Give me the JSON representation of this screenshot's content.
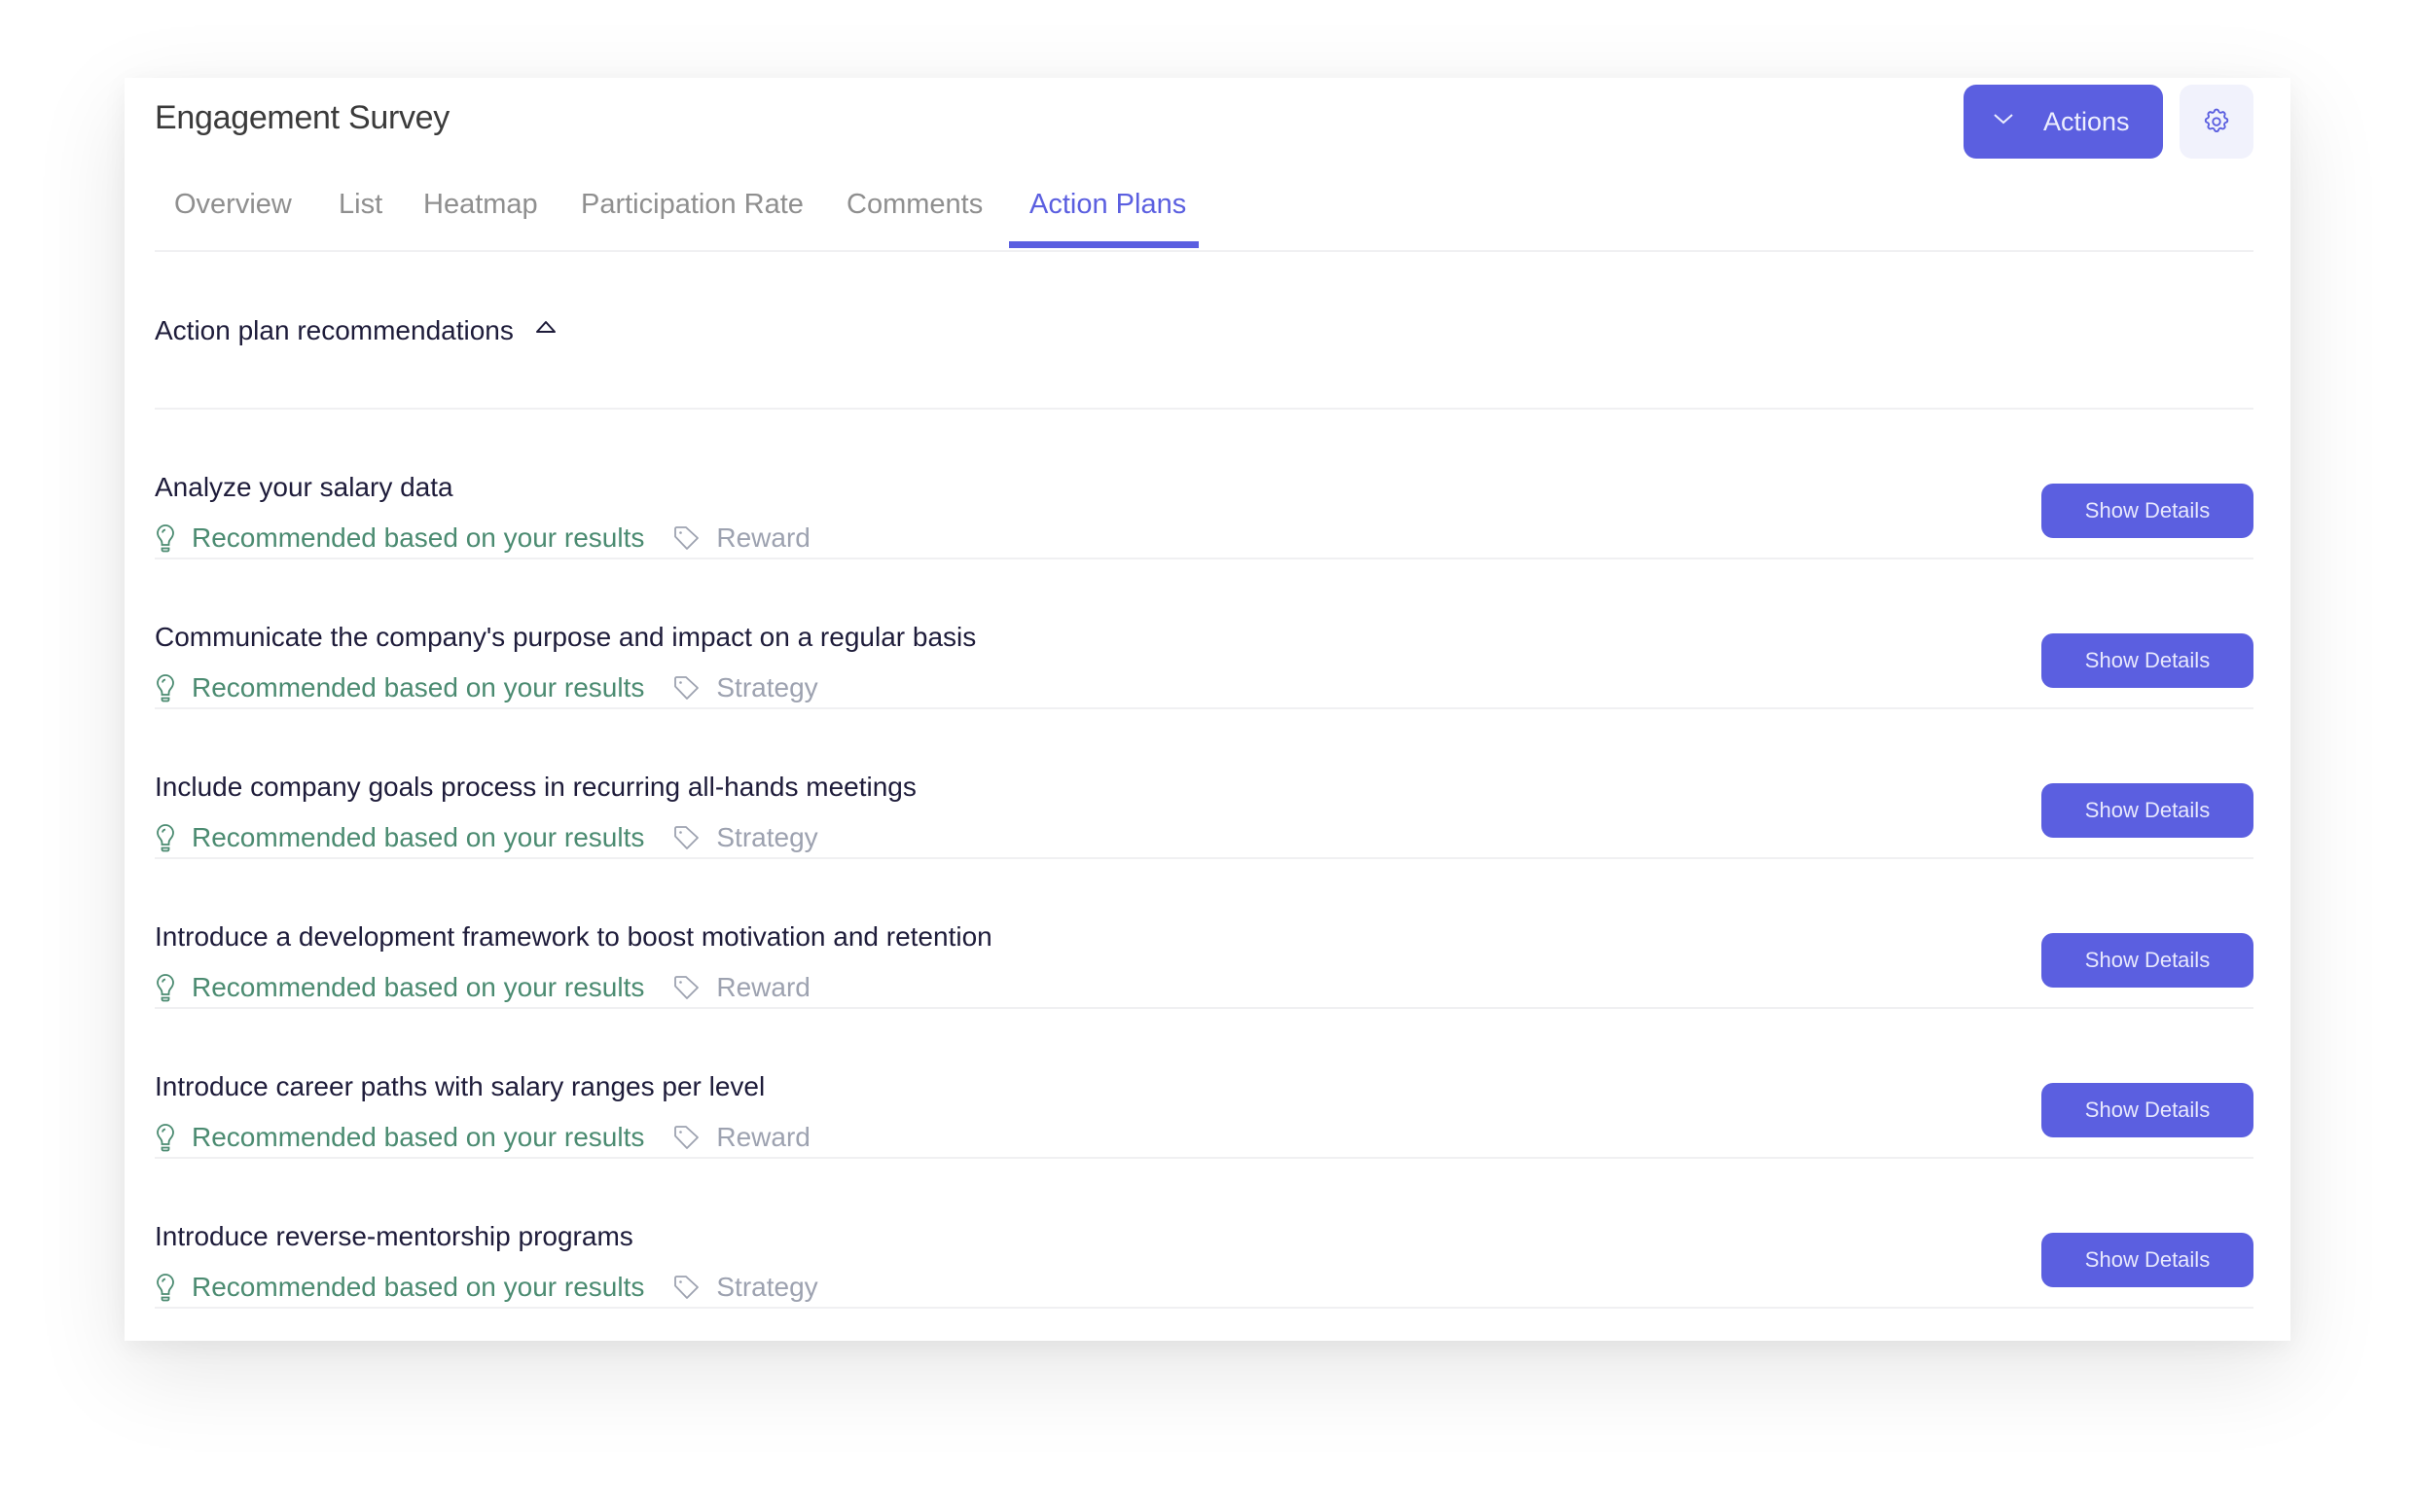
{
  "header": {
    "title": "Engagement Survey",
    "actions_label": "Actions",
    "actions_icon": "chevron-down-icon",
    "settings_icon": "gear-icon"
  },
  "tabs": [
    {
      "label": "Overview",
      "active": false
    },
    {
      "label": "List",
      "active": false
    },
    {
      "label": "Heatmap",
      "active": false
    },
    {
      "label": "Participation Rate",
      "active": false
    },
    {
      "label": "Comments",
      "active": false
    },
    {
      "label": "Action Plans",
      "active": true
    }
  ],
  "section": {
    "title": "Action plan recommendations",
    "expanded": true
  },
  "items": [
    {
      "title": "Analyze your salary data",
      "recommendation": "Recommended based on your results",
      "category": "Reward",
      "button": "Show Details"
    },
    {
      "title": "Communicate the company's purpose and impact on a regular basis",
      "recommendation": "Recommended based on your results",
      "category": "Strategy",
      "button": "Show Details"
    },
    {
      "title": "Include company goals process in recurring all-hands meetings",
      "recommendation": "Recommended based on your results",
      "category": "Strategy",
      "button": "Show Details"
    },
    {
      "title": "Introduce a development framework to boost motivation and retention",
      "recommendation": "Recommended based on your results",
      "category": "Reward",
      "button": "Show Details"
    },
    {
      "title": "Introduce career paths with salary ranges per level",
      "recommendation": "Recommended based on your results",
      "category": "Reward",
      "button": "Show Details"
    },
    {
      "title": "Introduce reverse-mentorship programs",
      "recommendation": "Recommended based on your results",
      "category": "Strategy",
      "button": "Show Details"
    }
  ],
  "colors": {
    "accent": "#5b5fe0",
    "recommendation": "#4b8b71",
    "category": "#9da2b0",
    "text": "#1e1c3a"
  }
}
